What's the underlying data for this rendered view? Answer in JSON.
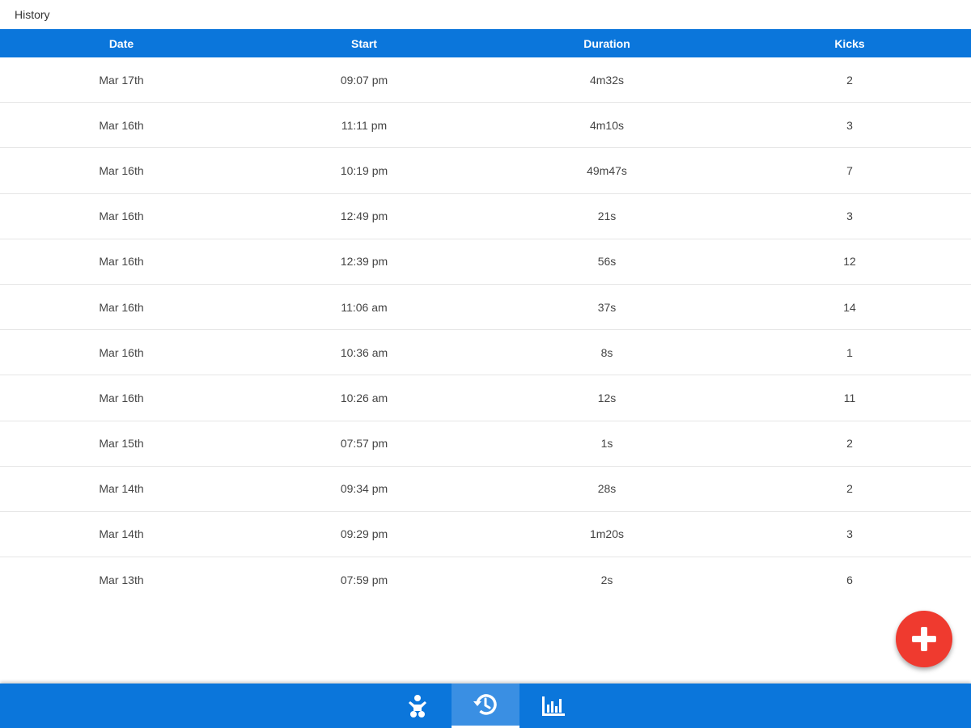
{
  "window": {
    "title": "History"
  },
  "table": {
    "headers": [
      "Date",
      "Start",
      "Duration",
      "Kicks"
    ],
    "rows": [
      [
        "Mar 17th",
        "09:07 pm",
        "4m32s",
        "2"
      ],
      [
        "Mar 16th",
        "11:11 pm",
        "4m10s",
        "3"
      ],
      [
        "Mar 16th",
        "10:19 pm",
        "49m47s",
        "7"
      ],
      [
        "Mar 16th",
        "12:49 pm",
        "21s",
        "3"
      ],
      [
        "Mar 16th",
        "12:39 pm",
        "56s",
        "12"
      ],
      [
        "Mar 16th",
        "11:06 am",
        "37s",
        "14"
      ],
      [
        "Mar 16th",
        "10:36 am",
        "8s",
        "1"
      ],
      [
        "Mar 16th",
        "10:26 am",
        "12s",
        "11"
      ],
      [
        "Mar 15th",
        "07:57 pm",
        "1s",
        "2"
      ],
      [
        "Mar 14th",
        "09:34 pm",
        "28s",
        "2"
      ],
      [
        "Mar 14th",
        "09:29 pm",
        "1m20s",
        "3"
      ],
      [
        "Mar 13th",
        "07:59 pm",
        "2s",
        "6"
      ]
    ]
  },
  "fab": {
    "icon": "plus-icon"
  },
  "bottom_nav": {
    "tabs": [
      {
        "icon": "baby-icon",
        "active": false
      },
      {
        "icon": "history-icon",
        "active": true
      },
      {
        "icon": "bar-chart-icon",
        "active": false
      }
    ]
  },
  "colors": {
    "primary": "#0b76db",
    "active_tab": "#3a8fe3",
    "fab": "#ef3a2f",
    "divider": "#e6e6e6"
  }
}
